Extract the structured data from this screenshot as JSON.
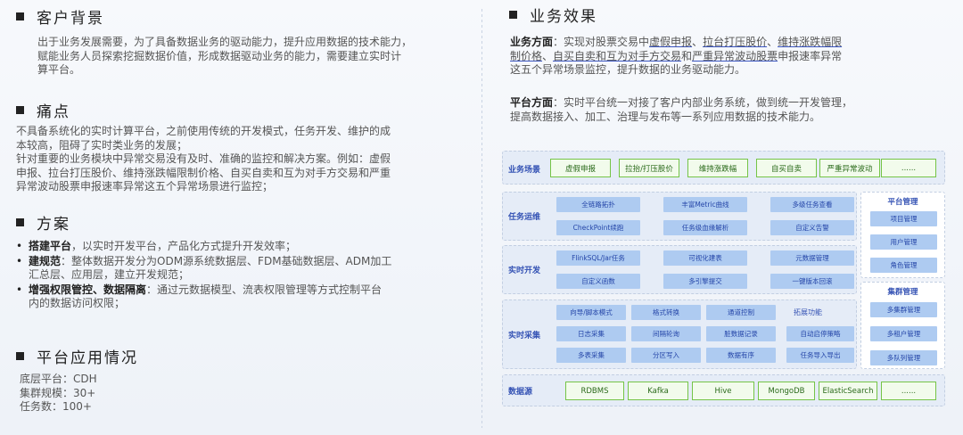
{
  "left": {
    "background": {
      "title": "客户背景",
      "lines": [
        "出于业务发展需要，为了具备数据业务的驱动能力，提升应用数据的技术能力，",
        "赋能业务人员探索挖掘数据价值，形成数据驱动业务的能力，需要建立实时计",
        "算平台。"
      ]
    },
    "pain": {
      "title": "痛点",
      "lines": [
        "不具备系统化的实时计算平台，之前使用传统的开发模式，任务开发、维护的成",
        "本较高，阻碍了实时类业务的发展；",
        "针对重要的业务模块中异常交易没有及时、准确的监控和解决方案。例如：虚假",
        "申报、拉台打压股价、维持涨跌幅限制价格、自买自卖和互为对手方交易和严重",
        "异常波动股票申报速率异常这五个异常场景进行监控；"
      ]
    },
    "plan": {
      "title": "方案",
      "items": [
        {
          "bold": "搭建平台",
          "text": "，以实时开发平台，产品化方式提升开发效率；",
          "cont": ""
        },
        {
          "bold": "建规范",
          "text": "：整体数据开发分为ODM源系统数据层、FDM基础数据层、ADM加工",
          "cont": "汇总层、应用层，建立开发规范；"
        },
        {
          "bold": "增强权限管控、数据隔离",
          "text": "：通过元数据模型、流表权限管理等方式控制平台",
          "cont": "内的数据访问权限；"
        }
      ]
    },
    "usage": {
      "title": "平台应用情况",
      "lines": [
        "底层平台：CDH",
        "集群规模：30+",
        "任务数：100+"
      ]
    }
  },
  "right": {
    "effect": {
      "title": "业务效果",
      "business_label": "业务方面",
      "business_pre": "：实现对股票交易中",
      "u1": "虚假申报",
      "sep1": "、",
      "u2": "拉台打压股价",
      "sep2": "、",
      "u3": "维持涨跌幅限",
      "u3b": "制价格",
      "sep3": "、",
      "u4": "自买自卖和互为对手方交易",
      "sep4": "和",
      "u5": "严重异常波动股票",
      "business_post": "申报速率异常",
      "business_line3": "这五个异常场景监控，提升数据的业务驱动能力。",
      "platform_label": "平台方面",
      "platform_text1": "：实时平台统一对接了客户内部业务系统，做到统一开发管理，",
      "platform_text2": "提高数据接入、加工、治理与发布等一系列应用数据的技术能力。"
    }
  },
  "diagram": {
    "scene_label": "业务场景",
    "scenes": [
      "虚假申报",
      "拉抬/打压股价",
      "维持涨跌幅",
      "自买自卖",
      "严重异常波动",
      "......"
    ],
    "ops_label": "任务运维",
    "ops": [
      "全链路拓扑",
      "丰富Metric曲线",
      "多级任务查看",
      "CheckPoint续跑",
      "任务级血缘解析",
      "自定义告警"
    ],
    "dev_label": "实时开发",
    "dev": [
      "FlinkSQL/Jar任务",
      "可视化建表",
      "元数据管理",
      "自定义函数",
      "多引擎提交",
      "一键版本回滚"
    ],
    "collect_label": "实时采集",
    "collect": [
      "向导/脚本模式",
      "格式转换",
      "通道控制",
      "日志采集",
      "间隔轮询",
      "脏数据记录",
      "多表采集",
      "分区写入",
      "数据有序"
    ],
    "ext_label": "拓展功能",
    "ext": [
      "自动启停策略",
      "任务导入导出"
    ],
    "platform_mgmt": {
      "title": "平台管理",
      "items": [
        "项目管理",
        "用户管理",
        "角色管理"
      ]
    },
    "cluster_mgmt": {
      "title": "集群管理",
      "items": [
        "多集群管理",
        "多租户管理",
        "多队列管理"
      ]
    },
    "source_label": "数据源",
    "sources": [
      "RDBMS",
      "Kafka",
      "Hive",
      "MongoDB",
      "ElasticSearch",
      "......"
    ],
    "colors": {
      "green_border": "#75c447",
      "blue_fill": "#aecbf1",
      "band": "#e5ecf7",
      "label": "#3452b4"
    }
  }
}
